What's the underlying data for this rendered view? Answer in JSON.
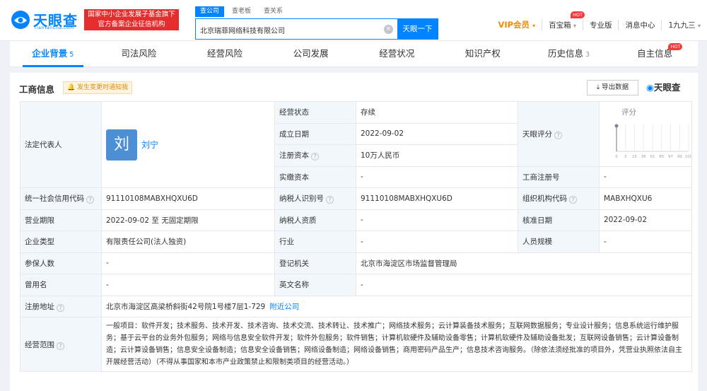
{
  "header": {
    "logo_cn": "天眼查",
    "logo_en": "TianYanCha.com",
    "promo_line1": "国家中小企业发展子基金旗下",
    "promo_line2": "官方备案企业征信机构",
    "search_tabs": [
      "查公司",
      "查老板",
      "查关系"
    ],
    "search_value": "北京瑞菲网络科技有限公司",
    "search_button": "天眼一下",
    "nav": {
      "vip": "VIP会员",
      "box": "百宝箱",
      "hot": "HOT",
      "pro": "专业版",
      "msg": "消息中心",
      "user": "1九九三"
    }
  },
  "tabs": [
    {
      "label": "企业背景",
      "count": "5"
    },
    {
      "label": "司法风险",
      "count": ""
    },
    {
      "label": "经营风险",
      "count": ""
    },
    {
      "label": "公司发展",
      "count": ""
    },
    {
      "label": "经营状况",
      "count": ""
    },
    {
      "label": "知识产权",
      "count": ""
    },
    {
      "label": "历史信息",
      "count": "3"
    },
    {
      "label": "自主信息",
      "count": "",
      "hot": "HOT"
    }
  ],
  "panel": {
    "title": "工商信息",
    "notify": "发生变更时通知我",
    "export": "导出数据",
    "brand": "天眼查"
  },
  "info": {
    "legal_label": "法定代表人",
    "legal_avatar": "刘",
    "legal_name": "刘宁",
    "status_label": "经营状态",
    "status": "存续",
    "found_label": "成立日期",
    "found": "2022-09-02",
    "capital_label": "注册资本",
    "capital": "10万人民币",
    "paid_label": "实缴资本",
    "paid": "-",
    "score_label": "天眼评分",
    "score_title": "评分",
    "reg_no_label": "工商注册号",
    "reg_no": "-",
    "credit_label": "统一社会信用代码",
    "credit": "91110108MABXHQXU6D",
    "tax_label": "纳税人识别号",
    "tax": "91110108MABXHQXU6D",
    "org_label": "组织机构代码",
    "org": "MABXHQXU6",
    "term_label": "营业期限",
    "term": "2022-09-02 至 无固定期限",
    "taxq_label": "纳税人资质",
    "taxq": "-",
    "approve_label": "核准日期",
    "approve": "2022-09-02",
    "type_label": "企业类型",
    "type": "有限责任公司(法人独资)",
    "industry_label": "行业",
    "industry": "-",
    "staff_label": "人员规模",
    "staff": "-",
    "insured_label": "参保人数",
    "insured": "-",
    "authority_label": "登记机关",
    "authority": "北京市海淀区市场监督管理局",
    "former_label": "曾用名",
    "former": "-",
    "en_label": "英文名称",
    "en": "-",
    "addr_label": "注册地址",
    "addr": "北京市海淀区高梁桥斜街42号院1号楼7层1-729",
    "addr_link": "附近公司",
    "scope_label": "经营范围",
    "scope": "一般项目：软件开发；技术服务、技术开发、技术咨询、技术交流、技术转让、技术推广；网络技术服务；云计算装备技术服务；互联网数据服务；专业设计服务；信息系统运行维护服务；基于云平台的业务外包服务；网络与信息安全软件开发；软件外包服务；软件销售；计算机软硬件及辅助设备零售；计算机软硬件及辅助设备批发；互联网设备销售；云计算设备制造；云计算设备销售；信息安全设备制造；信息安全设备销售；网络设备制造；网络设备销售；商用密码产品生产；信息技术咨询服务。（除依法须经批准的项目外，凭营业执照依法自主开展经营活动）（不得从事国家和本市产业政策禁止和限制类项目的经营活动。）"
  },
  "chart_data": {
    "type": "bar",
    "title": "评分",
    "categories": [
      "0",
      "3",
      "15",
      "36",
      "61",
      "85",
      "97",
      "99",
      "100"
    ],
    "values": [
      0,
      0,
      0,
      0,
      0,
      0,
      0,
      0,
      0
    ],
    "marker_category": "0",
    "xlabel": "",
    "ylabel": ""
  },
  "colors": {
    "brand": "#0084ff",
    "vip": "#f28b05",
    "hot": "#f43b3b",
    "promo": "#e52d2d"
  }
}
